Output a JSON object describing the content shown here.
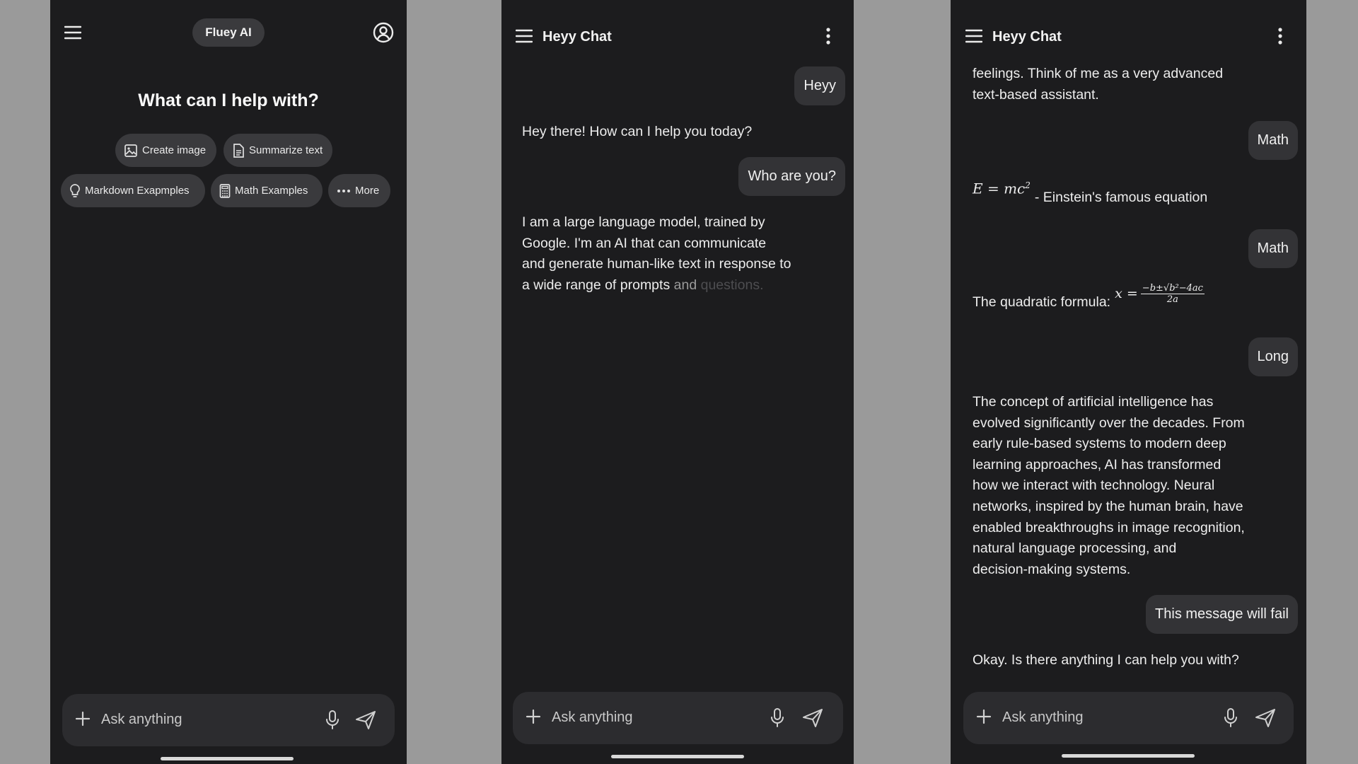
{
  "screen1": {
    "app_title": "Fluey AI",
    "headline": "What can I help with?",
    "chips": [
      {
        "label": "Create image",
        "icon": "image-icon"
      },
      {
        "label": "Summarize text",
        "icon": "document-icon"
      },
      {
        "label": "Markdown Exapmples",
        "icon": "lightbulb-icon"
      },
      {
        "label": "Math Examples",
        "icon": "calculator-icon"
      },
      {
        "label": "More",
        "icon": "more-horizontal-icon"
      }
    ],
    "input_placeholder": "Ask anything"
  },
  "screen2": {
    "title": "Heyy Chat",
    "messages": [
      {
        "role": "user",
        "text": "Heyy"
      },
      {
        "role": "assistant",
        "text": "Hey there! How can I help you today?"
      },
      {
        "role": "user",
        "text": "Who are you?"
      },
      {
        "role": "assistant",
        "lines": [
          "I am a large language model, trained by",
          "Google.  I'm an AI that can communicate",
          "and generate human-like text in response to",
          "a wide range of prompts"
        ],
        "streaming_tail_1": "and",
        "streaming_tail_2": "questions."
      }
    ],
    "input_placeholder": "Ask anything"
  },
  "screen3": {
    "title": "Heyy Chat",
    "partial_top_lines": [
      "feelings.  Think of me as a very advanced",
      "text-based assistant."
    ],
    "math1_user": "Math",
    "einstein_lhs": "E = mc",
    "einstein_exp": "2",
    "einstein_caption": "- Einstein's famous equation",
    "math2_user": "Math",
    "quadratic_label": "The quadratic formula:",
    "quadratic_lhs": "x =",
    "quadratic_num": "−b±√b²−4ac",
    "quadratic_den": "2a",
    "long_user": "Long",
    "long_lines": [
      "The concept of artificial intelligence has",
      "evolved significantly over the decades. From",
      "early rule-based systems to modern deep",
      "learning approaches, AI has transformed",
      "how we interact with technology. Neural",
      "networks, inspired by the human brain, have",
      "enabled breakthroughs in image recognition,",
      "natural language processing, and",
      "decision-making systems."
    ],
    "fail_user": "This message will fail",
    "last_reply": "Okay.  Is there anything I can help you with?",
    "input_placeholder": "Ask anything"
  }
}
